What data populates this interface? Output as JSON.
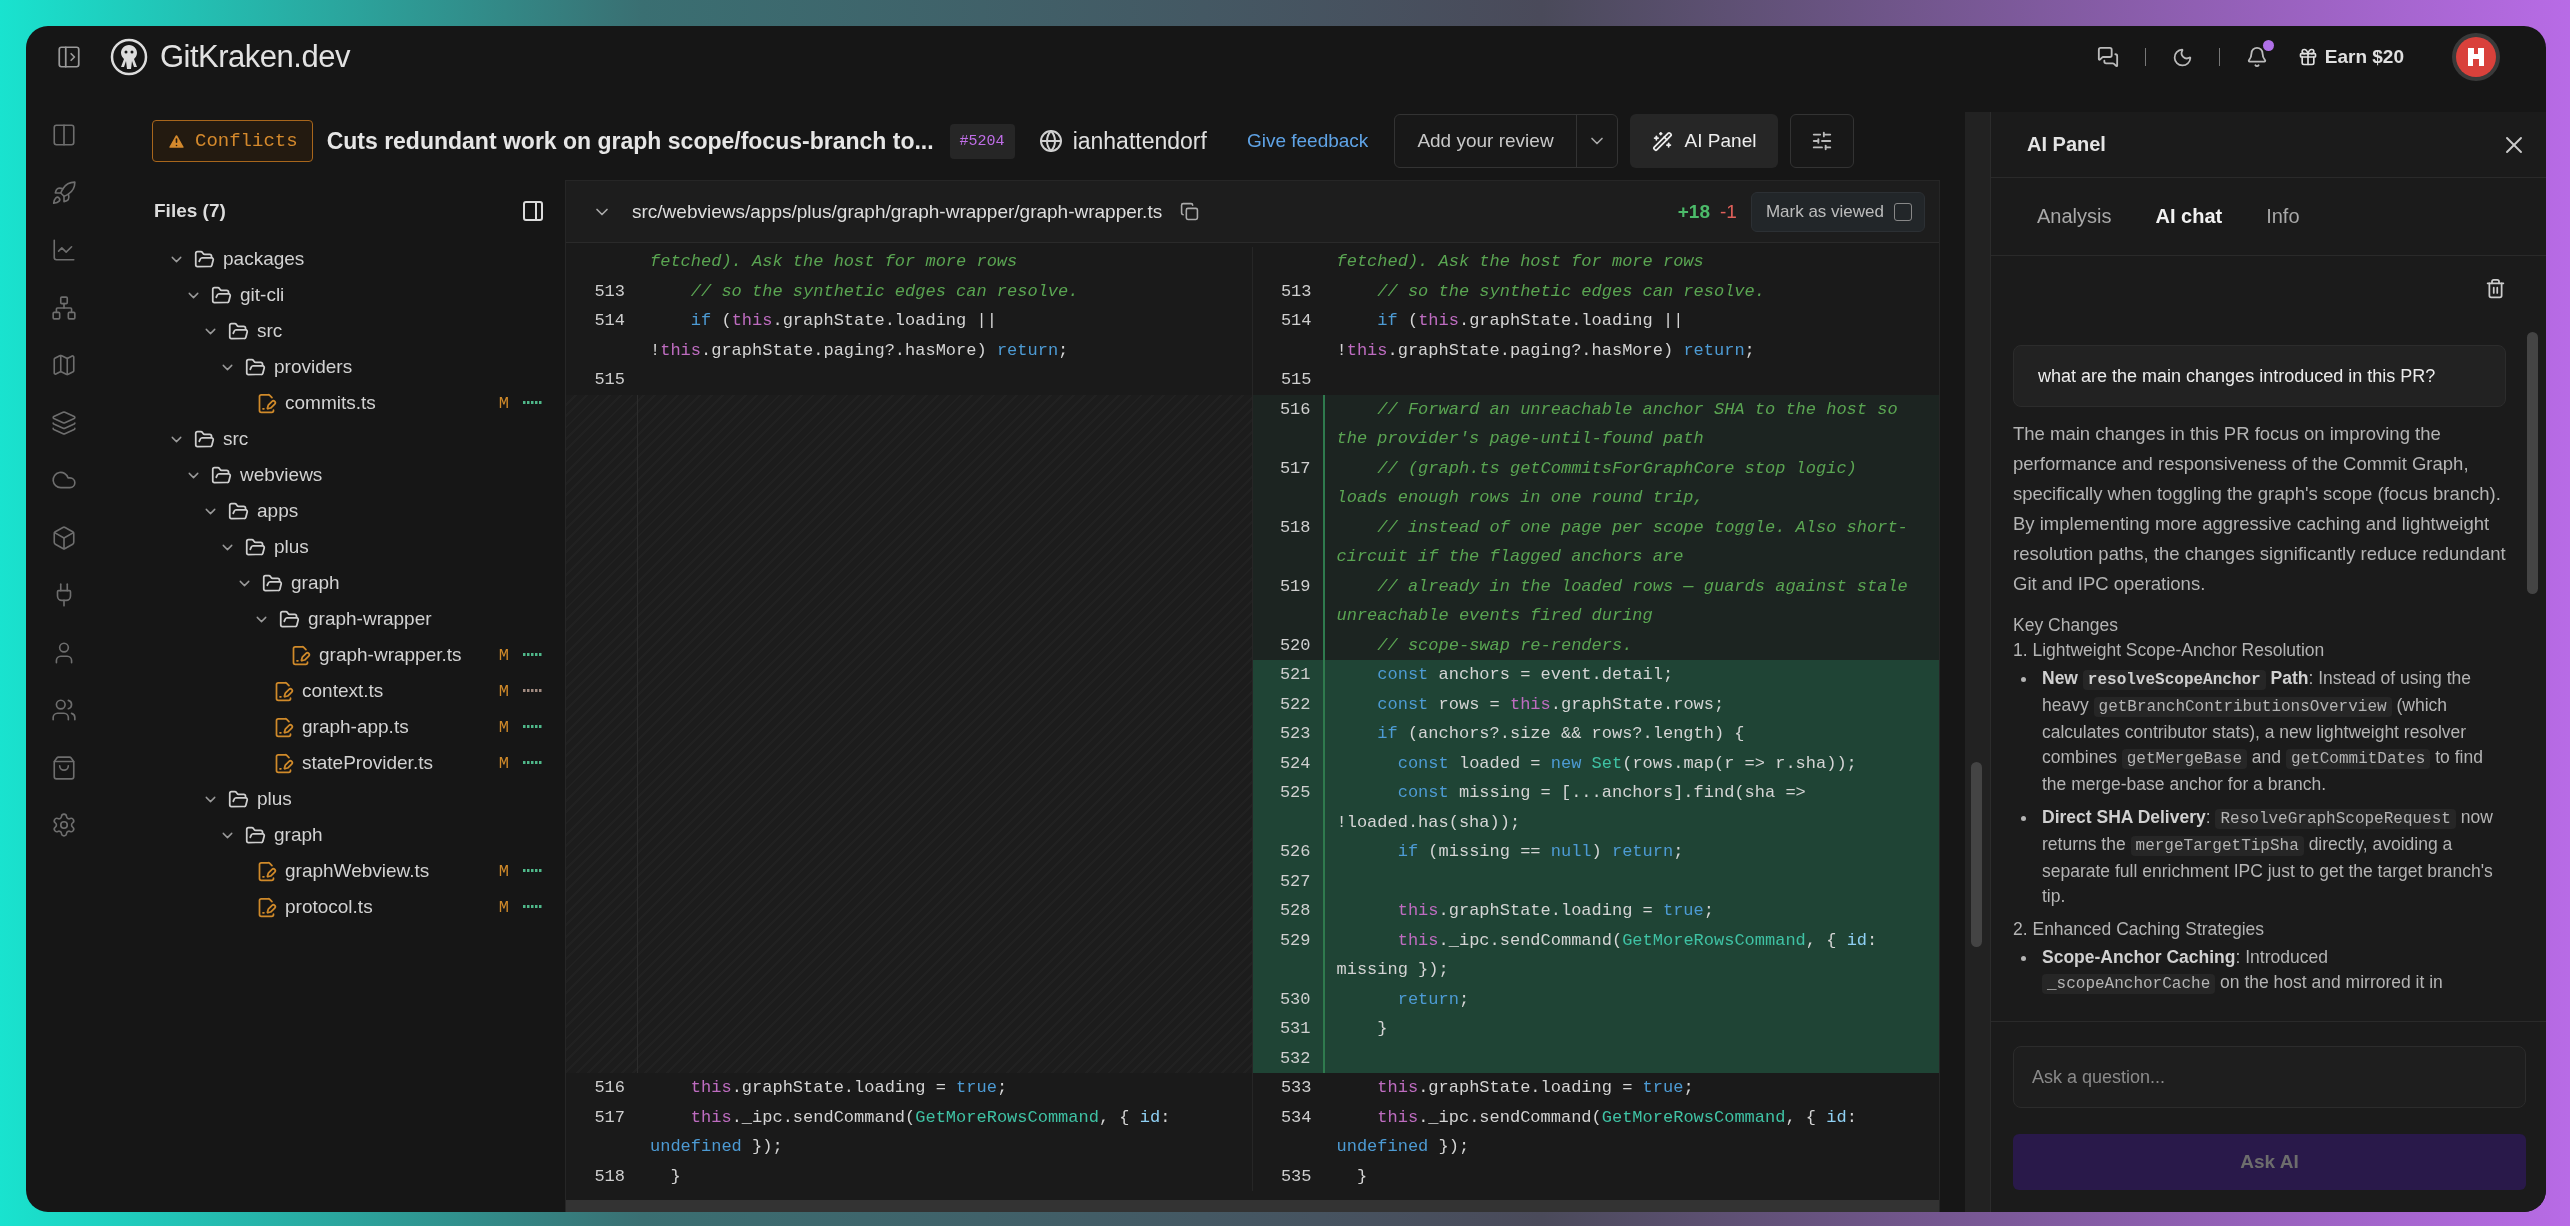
{
  "app": {
    "logo": "GitKraken.dev",
    "earn": "Earn $20",
    "notifications_unread": true
  },
  "pr": {
    "status": "Conflicts",
    "title": "Cuts redundant work on graph scope/focus-branch to...",
    "number": "#5204",
    "author": "ianhattendorf",
    "feedback": "Give feedback",
    "review_button": "Add your review",
    "ai_button": "AI Panel"
  },
  "files": {
    "title": "Files (7)",
    "tree": [
      {
        "kind": "folder",
        "name": "packages",
        "expanded": true,
        "children": [
          {
            "kind": "folder",
            "name": "git-cli",
            "expanded": true,
            "children": [
              {
                "kind": "folder",
                "name": "src",
                "expanded": true,
                "children": [
                  {
                    "kind": "folder",
                    "name": "providers",
                    "expanded": true,
                    "children": [
                      {
                        "kind": "file",
                        "name": "commits.ts",
                        "status": "M",
                        "color": "#4fb88a"
                      }
                    ]
                  }
                ]
              }
            ]
          }
        ]
      },
      {
        "kind": "folder",
        "name": "src",
        "expanded": true,
        "children": [
          {
            "kind": "folder",
            "name": "webviews",
            "expanded": true,
            "children": [
              {
                "kind": "folder",
                "name": "apps",
                "expanded": true,
                "children": [
                  {
                    "kind": "folder",
                    "name": "plus",
                    "expanded": true,
                    "children": [
                      {
                        "kind": "folder",
                        "name": "graph",
                        "expanded": true,
                        "children": [
                          {
                            "kind": "folder",
                            "name": "graph-wrapper",
                            "expanded": true,
                            "children": [
                              {
                                "kind": "file",
                                "name": "graph-wrapper.ts",
                                "status": "M",
                                "color": "#4fb88a"
                              }
                            ]
                          },
                          {
                            "kind": "file",
                            "name": "context.ts",
                            "status": "M",
                            "color": "#a08a80"
                          },
                          {
                            "kind": "file",
                            "name": "graph-app.ts",
                            "status": "M",
                            "color": "#4fb88a"
                          },
                          {
                            "kind": "file",
                            "name": "stateProvider.ts",
                            "status": "M",
                            "color": "#4fb88a"
                          }
                        ]
                      }
                    ]
                  }
                ]
              },
              {
                "kind": "folder",
                "name": "plus",
                "expanded": true,
                "children": [
                  {
                    "kind": "folder",
                    "name": "graph",
                    "expanded": true,
                    "children": [
                      {
                        "kind": "file",
                        "name": "graphWebview.ts",
                        "status": "M",
                        "color": "#4fb88a"
                      },
                      {
                        "kind": "file",
                        "name": "protocol.ts",
                        "status": "M",
                        "color": "#4fb88a"
                      }
                    ]
                  }
                ]
              }
            ]
          }
        ]
      }
    ]
  },
  "diff": {
    "path": "src/webviews/apps/plus/graph/graph-wrapper/graph-wrapper.ts",
    "additions": "+18",
    "deletions": "-1",
    "mark_viewed": {
      "label": "Mark as viewed",
      "checked": false
    },
    "hunks": [
      {
        "kind": "context",
        "left": [
          {
            "kind": "context",
            "tokens": [
              {
                "kind": "comment",
                "text": "fetched). Ask the host for more rows"
              }
            ]
          },
          {
            "kind": "context",
            "num": "513",
            "tokens": [
              {
                "kind": "comment",
                "text": "    // so the synthetic edges can resolve."
              }
            ]
          },
          {
            "kind": "context",
            "num": "514",
            "tokens": [
              {
                "kind": "keyword",
                "text": "    if"
              },
              {
                "kind": "plain",
                "text": " ("
              },
              {
                "kind": "this",
                "text": "this"
              },
              {
                "kind": "plain",
                "text": ".graphState.loading || !"
              },
              {
                "kind": "this",
                "text": "this"
              },
              {
                "kind": "plain",
                "text": ".graphState.paging?.hasMore) "
              },
              {
                "kind": "keyword",
                "text": "return"
              },
              {
                "kind": "plain",
                "text": ";"
              }
            ]
          },
          {
            "kind": "context",
            "num": "515"
          }
        ],
        "right": [
          {
            "kind": "context",
            "tokens": [
              {
                "kind": "comment",
                "text": "fetched). Ask the host for more rows"
              }
            ]
          },
          {
            "kind": "context",
            "num": "513",
            "tokens": [
              {
                "kind": "comment",
                "text": "    // so the synthetic edges can resolve."
              }
            ]
          },
          {
            "kind": "context",
            "num": "514",
            "tokens": [
              {
                "kind": "keyword",
                "text": "    if"
              },
              {
                "kind": "plain",
                "text": " ("
              },
              {
                "kind": "this",
                "text": "this"
              },
              {
                "kind": "plain",
                "text": ".graphState.loading || !"
              },
              {
                "kind": "this",
                "text": "this"
              },
              {
                "kind": "plain",
                "text": ".graphState.paging?.hasMore) "
              },
              {
                "kind": "keyword",
                "text": "return"
              },
              {
                "kind": "plain",
                "text": ";"
              }
            ]
          },
          {
            "kind": "context",
            "num": "515"
          }
        ]
      },
      {
        "kind": "added",
        "right": [
          {
            "kind": "muted",
            "num": "516",
            "tokens": [
              {
                "kind": "comment",
                "text": "    // Forward an unreachable anchor SHA to the host so the provider's page-until-found path"
              }
            ]
          },
          {
            "kind": "muted",
            "num": "517",
            "tokens": [
              {
                "kind": "comment",
                "text": "    // (graph.ts getCommitsForGraphCore stop logic) loads enough rows in one round trip,"
              }
            ]
          },
          {
            "kind": "muted",
            "num": "518",
            "tokens": [
              {
                "kind": "comment",
                "text": "    // instead of one page per scope toggle. Also short-circuit if the flagged anchors are"
              }
            ]
          },
          {
            "kind": "muted",
            "num": "519",
            "tokens": [
              {
                "kind": "comment",
                "text": "    // already in the loaded rows — guards against stale unreachable events fired during"
              }
            ]
          },
          {
            "kind": "muted",
            "num": "520",
            "tokens": [
              {
                "kind": "comment",
                "text": "    // scope-swap re-renders."
              }
            ]
          },
          {
            "kind": "added",
            "num": "521",
            "tokens": [
              {
                "kind": "keyword",
                "text": "    const"
              },
              {
                "kind": "plain",
                "text": " anchors = event.detail;"
              }
            ]
          },
          {
            "kind": "added",
            "num": "522",
            "tokens": [
              {
                "kind": "keyword",
                "text": "    const"
              },
              {
                "kind": "plain",
                "text": " rows = "
              },
              {
                "kind": "this",
                "text": "this"
              },
              {
                "kind": "plain",
                "text": ".graphState.rows;"
              }
            ]
          },
          {
            "kind": "added",
            "num": "523",
            "tokens": [
              {
                "kind": "keyword",
                "text": "    if"
              },
              {
                "kind": "plain",
                "text": " (anchors?.size && rows?.length) {"
              }
            ]
          },
          {
            "kind": "added",
            "num": "524",
            "tokens": [
              {
                "kind": "keyword",
                "text": "      const"
              },
              {
                "kind": "plain",
                "text": " loaded = "
              },
              {
                "kind": "keyword",
                "text": "new"
              },
              {
                "kind": "class",
                "text": " Set"
              },
              {
                "kind": "plain",
                "text": "(rows.map(r => r.sha));"
              }
            ]
          },
          {
            "kind": "added",
            "num": "525",
            "tokens": [
              {
                "kind": "keyword",
                "text": "      const"
              },
              {
                "kind": "plain",
                "text": " missing = [...anchors].find(sha => !loaded.has(sha));"
              }
            ]
          },
          {
            "kind": "added",
            "num": "526",
            "tokens": [
              {
                "kind": "keyword",
                "text": "      if"
              },
              {
                "kind": "plain",
                "text": " (missing == "
              },
              {
                "kind": "keyword",
                "text": "null"
              },
              {
                "kind": "plain",
                "text": ") "
              },
              {
                "kind": "keyword",
                "text": "return"
              },
              {
                "kind": "plain",
                "text": ";"
              }
            ]
          },
          {
            "kind": "added",
            "num": "527"
          },
          {
            "kind": "added",
            "num": "528",
            "tokens": [
              {
                "kind": "this",
                "text": "      this"
              },
              {
                "kind": "plain",
                "text": ".graphState.loading = "
              },
              {
                "kind": "keyword",
                "text": "true"
              },
              {
                "kind": "plain",
                "text": ";"
              }
            ]
          },
          {
            "kind": "added",
            "num": "529",
            "tokens": [
              {
                "kind": "this",
                "text": "      this"
              },
              {
                "kind": "plain",
                "text": "._ipc.sendCommand("
              },
              {
                "kind": "class",
                "text": "GetMoreRowsCommand"
              },
              {
                "kind": "plain",
                "text": ", { "
              },
              {
                "kind": "prop",
                "text": "id"
              },
              {
                "kind": "plain",
                "text": ": missing });"
              }
            ]
          },
          {
            "kind": "added",
            "num": "530",
            "tokens": [
              {
                "kind": "keyword",
                "text": "      return"
              },
              {
                "kind": "plain",
                "text": ";"
              }
            ]
          },
          {
            "kind": "added",
            "num": "531",
            "tokens": [
              {
                "kind": "plain",
                "text": "    }"
              }
            ]
          },
          {
            "kind": "added",
            "num": "532"
          }
        ]
      },
      {
        "kind": "context",
        "left": [
          {
            "kind": "context",
            "num": "516",
            "tokens": [
              {
                "kind": "this",
                "text": "    this"
              },
              {
                "kind": "plain",
                "text": ".graphState.loading = "
              },
              {
                "kind": "keyword",
                "text": "true"
              },
              {
                "kind": "plain",
                "text": ";"
              }
            ]
          },
          {
            "kind": "context",
            "num": "517",
            "tokens": [
              {
                "kind": "this",
                "text": "    this"
              },
              {
                "kind": "plain",
                "text": "._ipc.sendCommand("
              },
              {
                "kind": "class",
                "text": "GetMoreRowsCommand"
              },
              {
                "kind": "plain",
                "text": ", { "
              },
              {
                "kind": "prop",
                "text": "id"
              },
              {
                "kind": "plain",
                "text": ": "
              },
              {
                "kind": "keyword",
                "text": "undefined"
              },
              {
                "kind": "plain",
                "text": " });"
              }
            ]
          },
          {
            "kind": "context",
            "num": "518",
            "tokens": [
              {
                "kind": "plain",
                "text": "  }"
              }
            ]
          }
        ],
        "right": [
          {
            "kind": "context",
            "num": "533",
            "tokens": [
              {
                "kind": "this",
                "text": "    this"
              },
              {
                "kind": "plain",
                "text": ".graphState.loading = "
              },
              {
                "kind": "keyword",
                "text": "true"
              },
              {
                "kind": "plain",
                "text": ";"
              }
            ]
          },
          {
            "kind": "context",
            "num": "534",
            "tokens": [
              {
                "kind": "this",
                "text": "    this"
              },
              {
                "kind": "plain",
                "text": "._ipc.sendCommand("
              },
              {
                "kind": "class",
                "text": "GetMoreRowsCommand"
              },
              {
                "kind": "plain",
                "text": ", { "
              },
              {
                "kind": "prop",
                "text": "id"
              },
              {
                "kind": "plain",
                "text": ": "
              },
              {
                "kind": "keyword",
                "text": "undefined"
              },
              {
                "kind": "plain",
                "text": " });"
              }
            ]
          },
          {
            "kind": "context",
            "num": "535",
            "tokens": [
              {
                "kind": "plain",
                "text": "  }"
              }
            ]
          }
        ]
      }
    ]
  },
  "ai_panel": {
    "title": "AI Panel",
    "tabs": [
      {
        "label": "Analysis",
        "selected": false
      },
      {
        "label": "AI chat",
        "selected": true
      },
      {
        "label": "Info",
        "selected": false
      }
    ],
    "question": "what are the main changes introduced in this PR?",
    "answer": [
      {
        "kind": "paragraph",
        "parts": [
          {
            "kind": "text",
            "text": "The main changes in this PR focus on improving the performance and responsiveness of the Commit Graph, specifically when toggling the graph's scope (focus branch). By implementing more aggressive caching and lightweight resolution paths, the changes significantly reduce redundant Git and IPC operations."
          }
        ]
      },
      {
        "kind": "heading",
        "parts": [
          {
            "kind": "text",
            "text": "Key Changes"
          }
        ]
      },
      {
        "kind": "heading",
        "parts": [
          {
            "kind": "text",
            "text": "1. Lightweight Scope-Anchor Resolution"
          }
        ]
      },
      {
        "kind": "bullet",
        "parts": [
          {
            "kind": "bold",
            "text": "New "
          },
          {
            "kind": "boldcode",
            "text": "resolveScopeAnchor"
          },
          {
            "kind": "bold",
            "text": " Path"
          },
          {
            "kind": "text",
            "text": ": Instead of using the heavy "
          },
          {
            "kind": "code",
            "text": "getBranchContributionsOverview"
          },
          {
            "kind": "text",
            "text": " (which calculates contributor stats), a new lightweight resolver combines "
          },
          {
            "kind": "code",
            "text": "getMergeBase"
          },
          {
            "kind": "text",
            "text": " and "
          },
          {
            "kind": "code",
            "text": "getCommitDates"
          },
          {
            "kind": "text",
            "text": " to find the merge-base anchor for a branch."
          }
        ]
      },
      {
        "kind": "bullet",
        "parts": [
          {
            "kind": "bold",
            "text": "Direct SHA Delivery"
          },
          {
            "kind": "text",
            "text": ": "
          },
          {
            "kind": "code",
            "text": "ResolveGraphScopeRequest"
          },
          {
            "kind": "text",
            "text": " now returns the "
          },
          {
            "kind": "code",
            "text": "mergeTargetTipSha"
          },
          {
            "kind": "text",
            "text": " directly, avoiding a separate full enrichment IPC just to get the target branch's tip."
          }
        ]
      },
      {
        "kind": "heading",
        "parts": [
          {
            "kind": "text",
            "text": "2. Enhanced Caching Strategies"
          }
        ]
      },
      {
        "kind": "bullet",
        "parts": [
          {
            "kind": "bold",
            "text": "Scope-Anchor Caching"
          },
          {
            "kind": "text",
            "text": ": Introduced "
          },
          {
            "kind": "code",
            "text": "_scopeAnchorCache"
          },
          {
            "kind": "text",
            "text": " on the host and mirrored it in"
          }
        ]
      }
    ],
    "input": {
      "placeholder": "Ask a question..."
    },
    "submit": {
      "label": "Ask AI",
      "disabled": true
    }
  }
}
